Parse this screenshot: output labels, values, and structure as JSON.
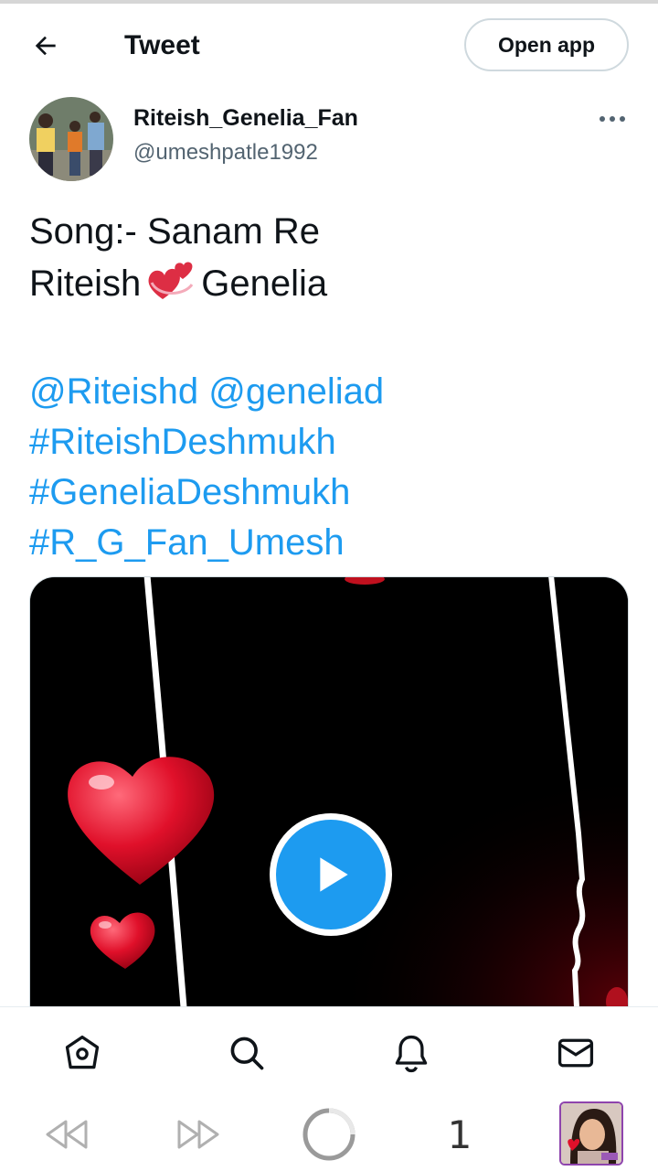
{
  "header": {
    "title": "Tweet",
    "open_app_label": "Open app",
    "back_icon": "arrow-left-icon"
  },
  "tweet": {
    "display_name": "Riteish_Genelia_Fan",
    "handle": "@umeshpatle1992",
    "line1": "Song:- Sanam Re",
    "line2_a": "Riteish",
    "line2_emoji": "revolving-hearts-emoji",
    "line2_b": "Genelia",
    "mention1": "@Riteishd",
    "mention2": "@geneliad",
    "hashtag1": "#RiteishDeshmukh",
    "hashtag2": "#GeneliaDeshmukh",
    "hashtag3": "#R_G_Fan_Umesh",
    "media_type": "video"
  },
  "bottom_nav": {
    "items": [
      "home-icon",
      "search-icon",
      "notifications-bell-icon",
      "messages-mail-icon"
    ]
  },
  "system_bar": {
    "tab_count": "1"
  },
  "colors": {
    "link": "#1d9bf0",
    "text": "#0f1419",
    "secondary": "#536471",
    "play": "#1d9bf0"
  }
}
